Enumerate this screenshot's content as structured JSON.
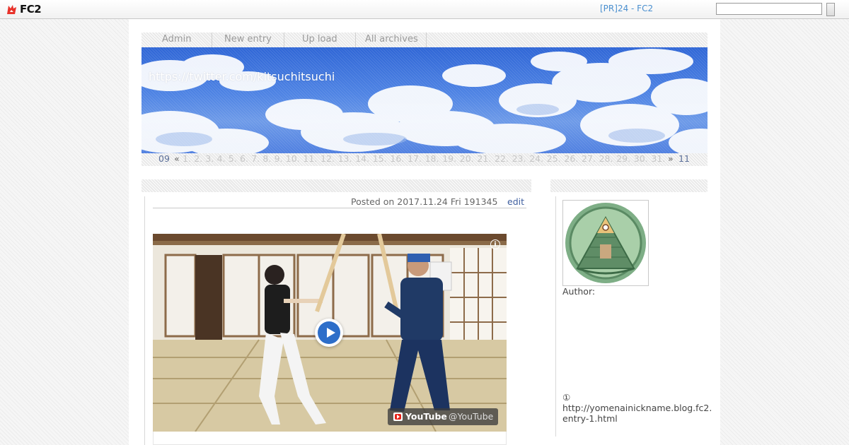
{
  "topbar": {
    "logo_text": "FC2",
    "pr_link": "[PR]24 - FC2",
    "search_placeholder": ""
  },
  "nav": {
    "items": [
      "Admin",
      "New entry",
      "Up load",
      "All archives"
    ]
  },
  "header": {
    "title": "https://twitter.com/kitsuchitsuchi"
  },
  "calendar": {
    "prev_month": "09",
    "prev_arrow": "«",
    "days": [
      "1",
      "2",
      "3",
      "4",
      "5",
      "6",
      "7",
      "8",
      "9",
      "10",
      "11",
      "12",
      "13",
      "14",
      "15",
      "16",
      "17",
      "18",
      "19",
      "20",
      "21",
      "22",
      "23",
      "24",
      "25",
      "26",
      "27",
      "28",
      "29",
      "30",
      "31"
    ],
    "next_arrow": "»",
    "next_month": "11"
  },
  "post": {
    "posted": "Posted on 2017.11.24 Fri 191345",
    "edit_label": "edit"
  },
  "video": {
    "info_icon": "i",
    "channel_name": "YouTube",
    "channel_handle": "@YouTube"
  },
  "sidebar": {
    "author_label": "Author:",
    "profile_note": "①\nhttp://yomenainickname.blog.fc2.\nentry-1.html"
  },
  "colors": {
    "link": "#4a8fcf",
    "accent_blue": "#2d6ec9",
    "youtube_red": "#e62117"
  }
}
